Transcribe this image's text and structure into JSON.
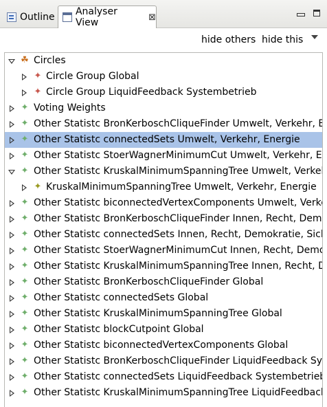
{
  "tabs": [
    {
      "label": "Outline",
      "icon": "outline-icon"
    },
    {
      "label": "Analyser View",
      "icon": "view-icon",
      "close_glyph": "⊠"
    }
  ],
  "toolbar": {
    "hide_others": "hide others",
    "hide_this": "hide this"
  },
  "tree": {
    "items": [
      {
        "label": "Circles"
      },
      {
        "label": "Circle Group Global"
      },
      {
        "label": "Circle Group LiquidFeedback Systembetrieb"
      },
      {
        "label": "Voting Weights"
      },
      {
        "label": "Other Statistc BronKerboschCliqueFinder Umwelt, Verkehr, Energie"
      },
      {
        "label": "Other Statistc connectedSets Umwelt, Verkehr, Energie"
      },
      {
        "label": "Other Statistc StoerWagnerMinimumCut Umwelt, Verkehr, Energie"
      },
      {
        "label": "Other Statistc KruskalMinimumSpanningTree Umwelt, Verkehr, Energie"
      },
      {
        "label": "KruskalMinimumSpanningTree Umwelt, Verkehr, Energie"
      },
      {
        "label": "Other Statistc biconnectedVertexComponents Umwelt, Verkehr, Energie"
      },
      {
        "label": "Other Statistc BronKerboschCliqueFinder Innen, Recht, Demokratie, Sicherheit"
      },
      {
        "label": "Other Statistc connectedSets Innen, Recht, Demokratie, Sicherheit"
      },
      {
        "label": "Other Statistc StoerWagnerMinimumCut Innen, Recht, Demokratie, Sicherheit"
      },
      {
        "label": "Other Statistc KruskalMinimumSpanningTree Innen, Recht, Demokratie, Sicherheit"
      },
      {
        "label": "Other Statistc BronKerboschCliqueFinder Global"
      },
      {
        "label": "Other Statistc connectedSets Global"
      },
      {
        "label": "Other Statistc KruskalMinimumSpanningTree Global"
      },
      {
        "label": "Other Statistc blockCutpoint Global"
      },
      {
        "label": "Other Statistc biconnectedVertexComponents Global"
      },
      {
        "label": "Other Statistc BronKerboschCliqueFinder LiquidFeedback Systembetrieb"
      },
      {
        "label": "Other Statistc connectedSets LiquidFeedback Systembetrieb"
      },
      {
        "label": "Other Statistc KruskalMinimumSpanningTree LiquidFeedback Systembetrieb"
      }
    ]
  }
}
